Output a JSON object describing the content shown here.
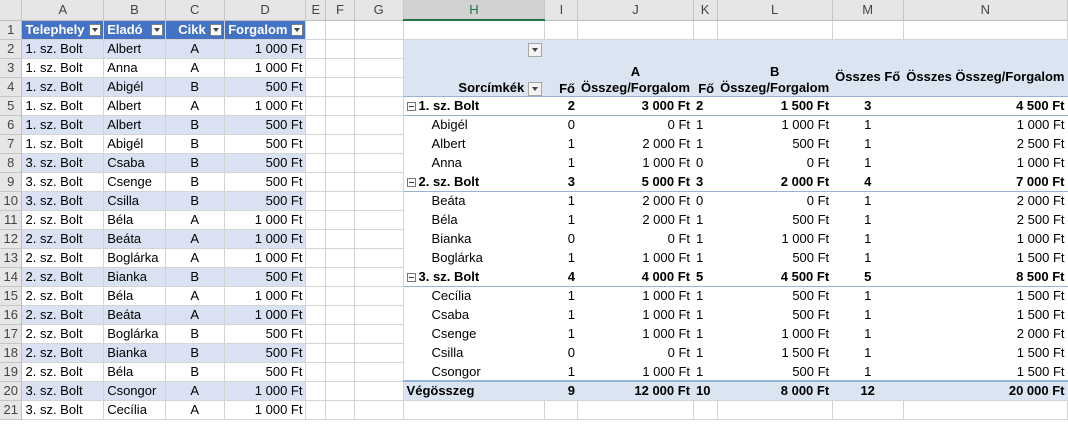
{
  "columns": [
    "A",
    "B",
    "C",
    "D",
    "E",
    "F",
    "G",
    "H",
    "I",
    "J",
    "K",
    "L",
    "M",
    "N"
  ],
  "rows": [
    "1",
    "2",
    "3",
    "4",
    "5",
    "6",
    "7",
    "8",
    "9",
    "10",
    "11",
    "12",
    "13",
    "14",
    "15",
    "16",
    "17",
    "18",
    "19",
    "20",
    "21"
  ],
  "table": {
    "headers": [
      "Telephely",
      "Eladó",
      "Cikk",
      "Forgalom"
    ],
    "rows": [
      [
        "1. sz. Bolt",
        "Albert",
        "A",
        "1 000 Ft"
      ],
      [
        "1. sz. Bolt",
        "Anna",
        "A",
        "1 000 Ft"
      ],
      [
        "1. sz. Bolt",
        "Abigél",
        "B",
        "500 Ft"
      ],
      [
        "1. sz. Bolt",
        "Albert",
        "A",
        "1 000 Ft"
      ],
      [
        "1. sz. Bolt",
        "Albert",
        "B",
        "500 Ft"
      ],
      [
        "1. sz. Bolt",
        "Abigél",
        "B",
        "500 Ft"
      ],
      [
        "3. sz. Bolt",
        "Csaba",
        "B",
        "500 Ft"
      ],
      [
        "3. sz. Bolt",
        "Csenge",
        "B",
        "500 Ft"
      ],
      [
        "3. sz. Bolt",
        "Csilla",
        "B",
        "500 Ft"
      ],
      [
        "2. sz. Bolt",
        "Béla",
        "A",
        "1 000 Ft"
      ],
      [
        "2. sz. Bolt",
        "Beáta",
        "A",
        "1 000 Ft"
      ],
      [
        "2. sz. Bolt",
        "Boglárka",
        "A",
        "1 000 Ft"
      ],
      [
        "2. sz. Bolt",
        "Bianka",
        "B",
        "500 Ft"
      ],
      [
        "2. sz. Bolt",
        "Béla",
        "A",
        "1 000 Ft"
      ],
      [
        "2. sz. Bolt",
        "Beáta",
        "A",
        "1 000 Ft"
      ],
      [
        "2. sz. Bolt",
        "Boglárka",
        "B",
        "500 Ft"
      ],
      [
        "2. sz. Bolt",
        "Bianka",
        "B",
        "500 Ft"
      ],
      [
        "2. sz. Bolt",
        "Béla",
        "B",
        "500 Ft"
      ],
      [
        "3. sz. Bolt",
        "Csongor",
        "A",
        "1 000 Ft"
      ],
      [
        "3. sz. Bolt",
        "Cecília",
        "A",
        "1 000 Ft"
      ]
    ]
  },
  "pivot": {
    "col_a": "A",
    "col_b": "B",
    "row_labels": "Sorcímkék",
    "fo": "Fő",
    "sum_label": "Összeg/Forgalom",
    "total_fo": "Összes Fő",
    "total_sum": "Összes Összeg/Forgalom",
    "rows": [
      {
        "type": "group",
        "label": "1. sz. Bolt",
        "v": [
          "2",
          "3 000 Ft",
          "2",
          "1 500 Ft",
          "3",
          "4 500 Ft"
        ]
      },
      {
        "type": "item",
        "label": "Abigél",
        "v": [
          "0",
          "0 Ft",
          "1",
          "1 000 Ft",
          "1",
          "1 000 Ft"
        ]
      },
      {
        "type": "item",
        "label": "Albert",
        "v": [
          "1",
          "2 000 Ft",
          "1",
          "500 Ft",
          "1",
          "2 500 Ft"
        ]
      },
      {
        "type": "item",
        "label": "Anna",
        "v": [
          "1",
          "1 000 Ft",
          "0",
          "0 Ft",
          "1",
          "1 000 Ft"
        ]
      },
      {
        "type": "group",
        "label": "2. sz. Bolt",
        "v": [
          "3",
          "5 000 Ft",
          "3",
          "2 000 Ft",
          "4",
          "7 000 Ft"
        ]
      },
      {
        "type": "item",
        "label": "Beáta",
        "v": [
          "1",
          "2 000 Ft",
          "0",
          "0 Ft",
          "1",
          "2 000 Ft"
        ]
      },
      {
        "type": "item",
        "label": "Béla",
        "v": [
          "1",
          "2 000 Ft",
          "1",
          "500 Ft",
          "1",
          "2 500 Ft"
        ]
      },
      {
        "type": "item",
        "label": "Bianka",
        "v": [
          "0",
          "0 Ft",
          "1",
          "1 000 Ft",
          "1",
          "1 000 Ft"
        ]
      },
      {
        "type": "item",
        "label": "Boglárka",
        "v": [
          "1",
          "1 000 Ft",
          "1",
          "500 Ft",
          "1",
          "1 500 Ft"
        ]
      },
      {
        "type": "group",
        "label": "3. sz. Bolt",
        "v": [
          "4",
          "4 000 Ft",
          "5",
          "4 500 Ft",
          "5",
          "8 500 Ft"
        ]
      },
      {
        "type": "item",
        "label": "Cecília",
        "v": [
          "1",
          "1 000 Ft",
          "1",
          "500 Ft",
          "1",
          "1 500 Ft"
        ]
      },
      {
        "type": "item",
        "label": "Csaba",
        "v": [
          "1",
          "1 000 Ft",
          "1",
          "500 Ft",
          "1",
          "1 500 Ft"
        ]
      },
      {
        "type": "item",
        "label": "Csenge",
        "v": [
          "1",
          "1 000 Ft",
          "1",
          "1 000 Ft",
          "1",
          "2 000 Ft"
        ]
      },
      {
        "type": "item",
        "label": "Csilla",
        "v": [
          "0",
          "0 Ft",
          "1",
          "1 500 Ft",
          "1",
          "1 500 Ft"
        ]
      },
      {
        "type": "item",
        "label": "Csongor",
        "v": [
          "1",
          "1 000 Ft",
          "1",
          "500 Ft",
          "1",
          "1 500 Ft"
        ]
      }
    ],
    "grand_total": {
      "label": "Végösszeg",
      "v": [
        "9",
        "12 000 Ft",
        "10",
        "8 000 Ft",
        "12",
        "20 000 Ft"
      ]
    }
  },
  "colors": {
    "table_header": "#4472c4",
    "table_band": "#d9e1f2",
    "pivot_header": "#dbe5f1",
    "selected_header": "#217346"
  }
}
